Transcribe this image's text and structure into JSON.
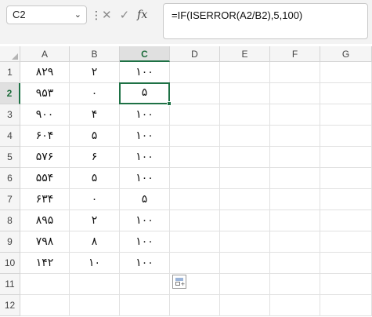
{
  "formula_bar": {
    "name_box": "C2",
    "formula": "=IF(ISERROR(A2/B2),5,100)",
    "icons": [
      "chevron-down-icon",
      "more-options-icon",
      "cancel-icon",
      "enter-icon",
      "insert-function-icon"
    ]
  },
  "columns": [
    "A",
    "B",
    "C",
    "D",
    "E",
    "F",
    "G"
  ],
  "rows": [
    "1",
    "2",
    "3",
    "4",
    "5",
    "6",
    "7",
    "8",
    "9",
    "10",
    "11",
    "12"
  ],
  "active_cell": {
    "column": "C",
    "row": "2"
  },
  "cells": {
    "A": [
      "۸۲۹",
      "۹۵۳",
      "۹۰۰",
      "۶۰۴",
      "۵۷۶",
      "۵۵۴",
      "۶۳۴",
      "۸۹۵",
      "۷۹۸",
      "۱۴۲"
    ],
    "B": [
      "۲",
      "۰",
      "۴",
      "۵",
      "۶",
      "۵",
      "۰",
      "۲",
      "۸",
      "۱۰"
    ],
    "C": [
      "۱۰۰",
      "۵",
      "۱۰۰",
      "۱۰۰",
      "۱۰۰",
      "۱۰۰",
      "۵",
      "۱۰۰",
      "۱۰۰",
      "۱۰۰"
    ]
  },
  "colors": {
    "accent": "#1e7145",
    "header_bg": "#f5f5f5",
    "gridline": "#e1e1e1"
  }
}
